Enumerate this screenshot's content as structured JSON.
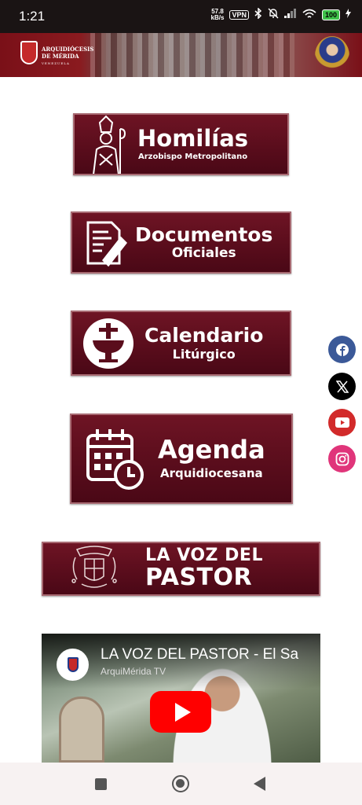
{
  "status_bar": {
    "time": "1:21",
    "speed_value": "57.8",
    "speed_unit": "kB/s",
    "vpn": "VPN",
    "battery": "100"
  },
  "header": {
    "logo_line1": "ARQUIDIÓCESIS",
    "logo_line2": "DE MÉRIDA",
    "logo_line3": "VENEZUELA"
  },
  "buttons": {
    "homilias": {
      "title": "Homilías",
      "subtitle": "Arzobispo Metropolitano",
      "icon": "bishop-icon"
    },
    "documentos": {
      "title": "Documentos",
      "subtitle": "Oficiales",
      "icon": "document-pen-icon"
    },
    "calendario": {
      "title": "Calendario",
      "subtitle": "Litúrgico",
      "icon": "chalice-icon"
    },
    "agenda": {
      "title": "Agenda",
      "subtitle": "Arquidiocesana",
      "icon": "calendar-clock-icon"
    },
    "voz": {
      "line1": "LA VOZ DEL",
      "line2": "PASTOR",
      "icon": "coat-of-arms-icon"
    }
  },
  "social": {
    "facebook": "f",
    "x": "𝕏",
    "youtube": "▶",
    "instagram": "◎"
  },
  "video": {
    "title": "LA VOZ DEL PASTOR - El Sa",
    "channel": "ArquiMérida TV"
  },
  "colors": {
    "brand_maroon": "#5a0d1c",
    "status_bar": "#1a1414"
  }
}
